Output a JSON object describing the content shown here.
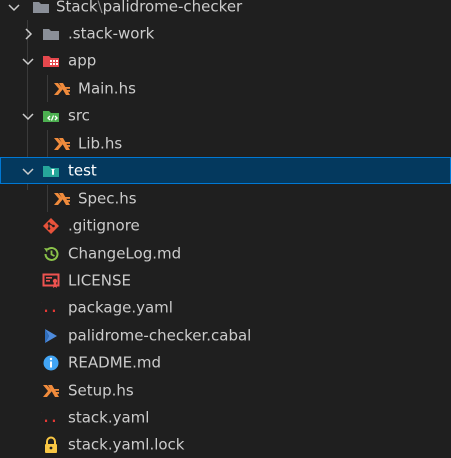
{
  "explorer": {
    "root": {
      "label_part1": "Stack",
      "separator": "\\",
      "label_part2": "palidrome-checker",
      "expanded": true
    },
    "items": [
      {
        "label": ".stack-work",
        "kind": "folder",
        "expanded": false,
        "icon": "folder-icon"
      },
      {
        "label": "app",
        "kind": "folder",
        "expanded": true,
        "icon": "app-folder-icon"
      },
      {
        "label": "Main.hs",
        "kind": "file",
        "icon": "haskell-icon"
      },
      {
        "label": "src",
        "kind": "folder",
        "expanded": true,
        "icon": "src-folder-icon"
      },
      {
        "label": "Lib.hs",
        "kind": "file",
        "icon": "haskell-icon"
      },
      {
        "label": "test",
        "kind": "folder",
        "expanded": true,
        "selected": true,
        "icon": "test-folder-icon"
      },
      {
        "label": "Spec.hs",
        "kind": "file",
        "icon": "haskell-icon"
      },
      {
        "label": ".gitignore",
        "kind": "file",
        "icon": "git-icon"
      },
      {
        "label": "ChangeLog.md",
        "kind": "file",
        "icon": "changelog-icon"
      },
      {
        "label": "LICENSE",
        "kind": "file",
        "icon": "license-icon"
      },
      {
        "label": "package.yaml",
        "kind": "file",
        "icon": "yaml-icon"
      },
      {
        "label": "palidrome-checker.cabal",
        "kind": "file",
        "icon": "cabal-icon"
      },
      {
        "label": "README.md",
        "kind": "file",
        "icon": "info-icon"
      },
      {
        "label": "Setup.hs",
        "kind": "file",
        "icon": "haskell-icon"
      },
      {
        "label": "stack.yaml",
        "kind": "file",
        "icon": "yaml-icon"
      },
      {
        "label": "stack.yaml.lock",
        "kind": "file",
        "icon": "lock-icon"
      }
    ]
  },
  "colors": {
    "background": "#1f1f1f",
    "selection": "#04395e",
    "selection_border": "#0078d4",
    "text": "#cccccc",
    "haskell": "#f08b3c",
    "git": "#e8533b",
    "changelog": "#8bc34a",
    "license": "#ef5350",
    "yaml": "#e53935",
    "cabal": "#4e8bdc",
    "info": "#42a5f5",
    "lock": "#f9c744"
  }
}
